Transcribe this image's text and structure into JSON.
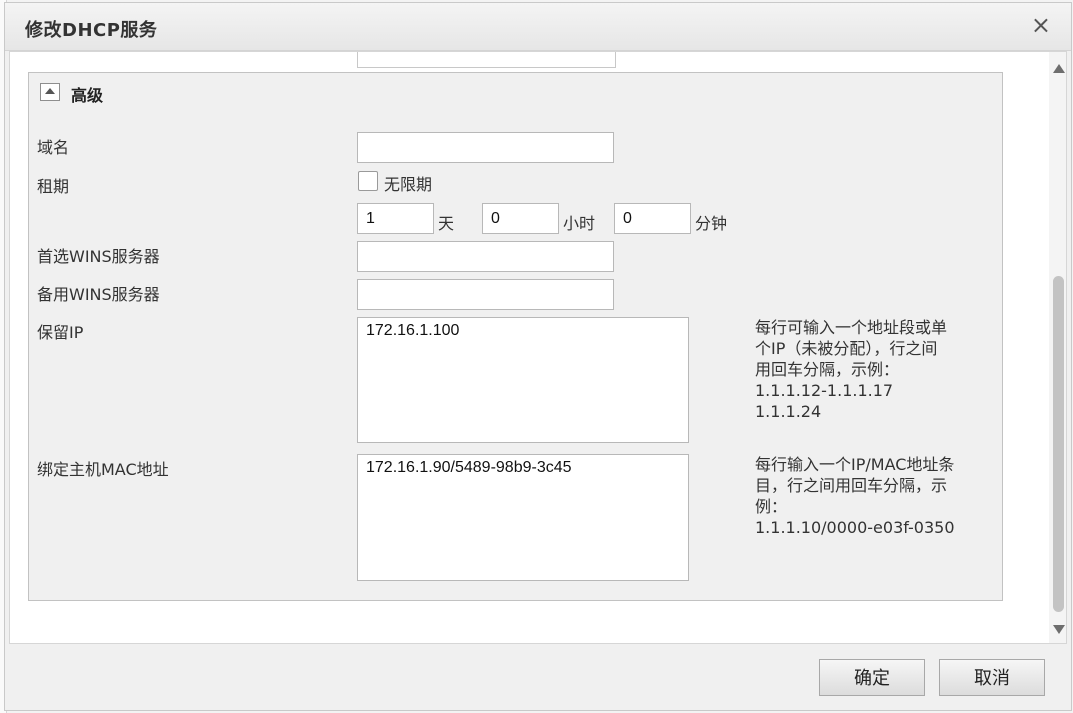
{
  "dialog": {
    "title": "修改DHCP服务",
    "close_glyph": "×"
  },
  "advanced": {
    "title": "高级",
    "toggle_icon": "collapse-up-icon",
    "domain_label": "域名",
    "domain_value": "",
    "lease_label": "租期",
    "unlimited_label": "无限期",
    "unlimited_checked": false,
    "lease_days": "1",
    "day_unit": "天",
    "lease_hours": "0",
    "hour_unit": "小时",
    "lease_minutes": "0",
    "minute_unit": "分钟",
    "primary_wins_label": "首选WINS服务器",
    "primary_wins_value": "",
    "backup_wins_label": "备用WINS服务器",
    "backup_wins_value": "",
    "reserved_ip_label": "保留IP",
    "reserved_ip_value": "172.16.1.100",
    "reserved_ip_hint": [
      "每行可输入一个地址段或单",
      "个IP（未被分配），行之间",
      "用回车分隔，示例：",
      "1.1.1.12-1.1.1.17",
      "1.1.1.24"
    ],
    "mac_label": "绑定主机MAC地址",
    "mac_value": "172.16.1.90/5489-98b9-3c45",
    "mac_hint": [
      "每行输入一个IP/MAC地址条",
      "目，行之间用回车分隔，示",
      "例：",
      "1.1.1.10/0000-e03f-0350"
    ]
  },
  "footer": {
    "ok_label": "确定",
    "cancel_label": "取消"
  }
}
